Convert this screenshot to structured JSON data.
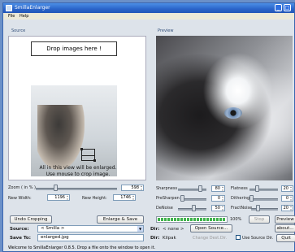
{
  "window": {
    "title": "SmillaEnlarger"
  },
  "menu": [
    "File",
    "Help"
  ],
  "panels": {
    "source_label": "Source",
    "preview_label": "Preview"
  },
  "source": {
    "drop_text": "Drop images here !",
    "hint_line1": "All in this view will be enlarged.",
    "hint_line2": "Use mouse to crop image."
  },
  "size": {
    "zoom_label": "Zoom ( in % )",
    "zoom_value": "598",
    "new_width_label": "New Width:",
    "new_width_value": "1196",
    "new_height_label": "New Height:",
    "new_height_value": "1746"
  },
  "params": {
    "sharpness": {
      "label": "Sharpness",
      "value": "80"
    },
    "flatness": {
      "label": "Flatness",
      "value": "20"
    },
    "presharpen": {
      "label": "PreSharpen",
      "value": "0"
    },
    "dithering": {
      "label": "Dithering",
      "value": "0"
    },
    "deNoise": {
      "label": "DeNoise",
      "value": "50"
    },
    "fractnoise": {
      "label": "FractNoise",
      "value": "20"
    }
  },
  "actions": {
    "undo_cropping": "Undo Cropping",
    "enlarge_save": "Enlarge & Save",
    "stop": "Stop",
    "preview": "Preview",
    "about": "about...",
    "quit": "Quit"
  },
  "progress": {
    "percent_label": "100%",
    "value": 100
  },
  "source_row": {
    "label": "Source:",
    "value": "< Smilla >"
  },
  "dir_row": {
    "label": "Dir:",
    "value": "< none >",
    "open_source": "Open Source..."
  },
  "save_row": {
    "label": "Save To:",
    "value": "enlarged.jpg"
  },
  "dest_row": {
    "label": "Dir:",
    "value": "Kilpak",
    "change_dest": "Change Dest.Dir.",
    "use_source_dir": "Use Source Dir."
  },
  "status": "Welcome to SmillaEnlarger 0.8.5.  Drop a file onto the window to open it."
}
